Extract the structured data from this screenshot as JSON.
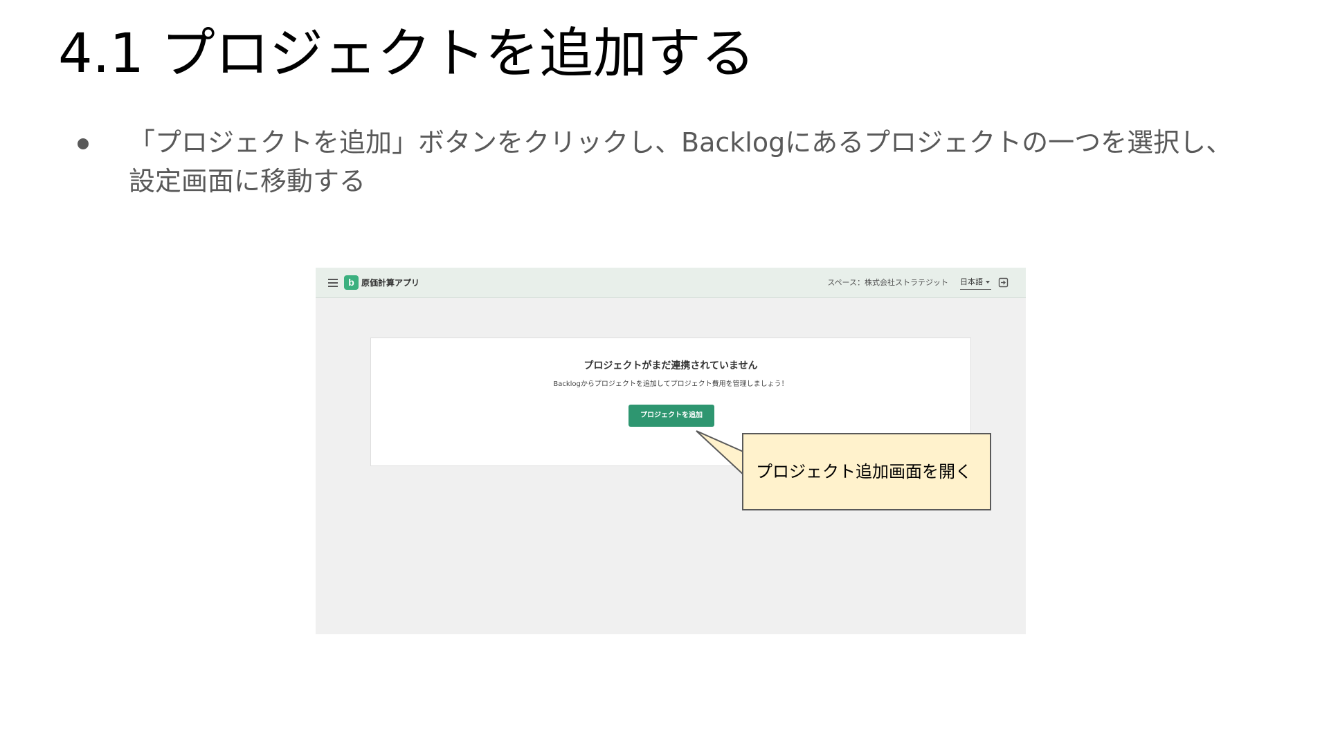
{
  "slide": {
    "title": "4.1 プロジェクトを追加する",
    "bullets": [
      "「プロジェクトを追加」ボタンをクリックし、Backlogにあるプロジェクトの一つを選択し、設定画面に移動する"
    ]
  },
  "app": {
    "logo_letter": "b",
    "name": "原価計算アプリ",
    "space_label": "スペース：株式会社ストラテジット",
    "language": "日本語",
    "empty_state": {
      "heading": "プロジェクトがまだ連携されていません",
      "description": "Backlogからプロジェクトを追加してプロジェクト費用を管理しましょう！",
      "button_label": "プロジェクトを追加"
    },
    "colors": {
      "header_bg": "#e8efea",
      "logo_green": "#3bb07f",
      "button_green": "#2e9670",
      "content_bg": "#f0f0f0"
    }
  },
  "callout": {
    "text": "プロジェクト追加画面を開く",
    "fill": "#fff2cc"
  },
  "icons": [
    "hamburger-menu-icon",
    "app-logo-icon",
    "dropdown-caret-icon",
    "logout-icon"
  ]
}
